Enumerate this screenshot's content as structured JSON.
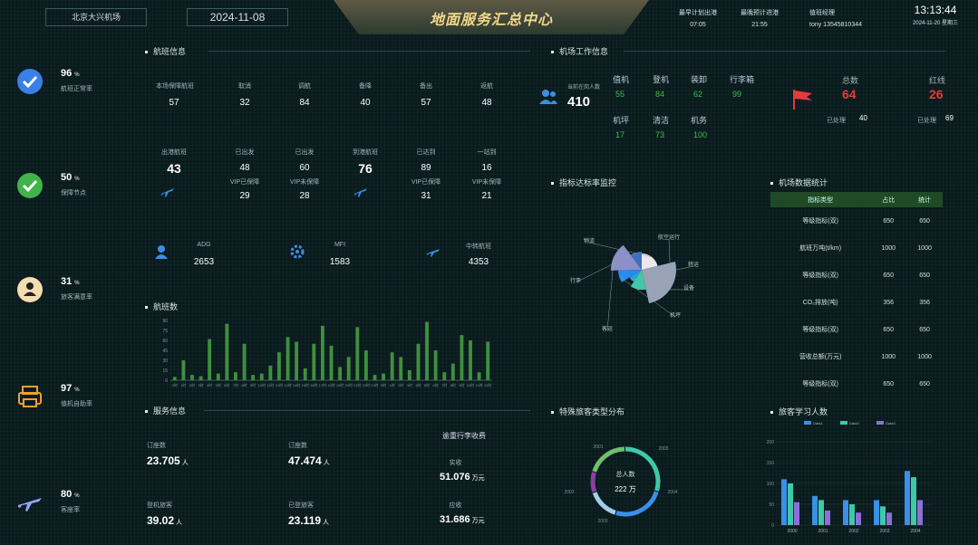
{
  "header": {
    "airport": "北京大兴机场",
    "date": "2024-11-08",
    "title": "地面服务汇总中心",
    "first_flight_label": "最早计划出港",
    "first_flight_time": "07:05",
    "last_flight_label": "最晚预计进港",
    "last_flight_time": "21:55",
    "duty_label": "值班经理",
    "duty_person": "tony 13545810344",
    "clock": "13:13:44",
    "clock_date": "2024-11-20 星期三"
  },
  "kpis": [
    {
      "value": "96",
      "unit": "%",
      "label": "航班正常率",
      "icon": "check-badge-icon"
    },
    {
      "value": "50",
      "unit": "%",
      "label": "保障节点",
      "icon": "check-circle-icon"
    },
    {
      "value": "31",
      "unit": "%",
      "label": "旅客满意率",
      "icon": "user-icon"
    },
    {
      "value": "97",
      "unit": "%",
      "label": "值机自助率",
      "icon": "printer-icon"
    },
    {
      "value": "80",
      "unit": "%",
      "label": "客座率",
      "icon": "plane-icon"
    }
  ],
  "flight_info": {
    "title": "航班信息",
    "row1": [
      {
        "label": "本场保障航班",
        "value": "57"
      },
      {
        "label": "取消",
        "value": "32"
      },
      {
        "label": "调航",
        "value": "84"
      },
      {
        "label": "备降",
        "value": "40"
      },
      {
        "label": "备出",
        "value": "57"
      },
      {
        "label": "返航",
        "value": "48"
      }
    ],
    "row2": [
      {
        "label": "出港航班",
        "value": "43",
        "big": true
      },
      {
        "label": "已出发",
        "value": "48"
      },
      {
        "label": "已出发",
        "value": "60"
      },
      {
        "label": "到港航班",
        "value": "76",
        "big": true
      },
      {
        "label": "已达到",
        "value": "89"
      },
      {
        "label": "一站到",
        "value": "16"
      }
    ],
    "row3": [
      {
        "label": "VIP已保障",
        "value": "29"
      },
      {
        "label": "VIP未保障",
        "value": "28"
      },
      {
        "label": "VIP已保障",
        "value": "31"
      },
      {
        "label": "VIP未保障",
        "value": "21"
      }
    ],
    "row4": [
      {
        "label": "ADG",
        "value": "2653",
        "icon": "user-icon"
      },
      {
        "label": "MFI",
        "value": "1583",
        "icon": "gear-icon"
      },
      {
        "label": "中转航班",
        "value": "4353",
        "icon": "plane-icon"
      }
    ]
  },
  "bar_chart": {
    "title": "航班数",
    "yticks": [
      "90",
      "75",
      "60",
      "45",
      "30",
      "15",
      "0"
    ]
  },
  "chart_data": [
    {
      "type": "bar",
      "title": "航班数",
      "categories": [
        "0时",
        "1时",
        "2时",
        "3时",
        "4时",
        "5时",
        "6时",
        "7时",
        "8时",
        "9时",
        "10时",
        "11时",
        "12时",
        "13时",
        "14时",
        "15时",
        "16时",
        "17时",
        "18时",
        "19时",
        "20时",
        "21时",
        "22时",
        "23时",
        "0时",
        "1时",
        "2时",
        "3时",
        "4时",
        "5时",
        "6时",
        "7时",
        "8时",
        "9时",
        "10时",
        "11时",
        "12时"
      ],
      "values": [
        5,
        30,
        8,
        6,
        62,
        10,
        85,
        12,
        55,
        8,
        10,
        22,
        42,
        65,
        58,
        18,
        55,
        82,
        52,
        20,
        35,
        80,
        45,
        8,
        10,
        42,
        35,
        15,
        55,
        88,
        45,
        12,
        25,
        68,
        60,
        12,
        58
      ],
      "ylim": [
        0,
        90
      ]
    },
    {
      "type": "pie",
      "title": "指标达标率监控",
      "categories": [
        "物流",
        "航空运行",
        "设备",
        "转运",
        "机坪",
        "客运",
        "行李"
      ],
      "values": [
        25,
        30,
        15,
        8,
        10,
        18,
        12
      ]
    },
    {
      "type": "pie",
      "title": "特殊旅客类型分布",
      "categories": [
        "2001",
        "2002",
        "2003",
        "2004",
        "2005"
      ],
      "values": [
        30,
        25,
        15,
        10,
        20
      ]
    },
    {
      "type": "bar",
      "title": "旅客学习人数",
      "categories": [
        "2000",
        "2001",
        "2002",
        "2003",
        "2004"
      ],
      "series": [
        {
          "name": "Data1",
          "values": [
            110,
            70,
            60,
            60,
            130
          ]
        },
        {
          "name": "Data2",
          "values": [
            100,
            60,
            50,
            45,
            115
          ]
        },
        {
          "name": "Data3",
          "values": [
            55,
            35,
            30,
            30,
            60
          ]
        }
      ],
      "ylim": [
        0,
        200
      ]
    }
  ],
  "service_info": {
    "title": "服务信息",
    "items": [
      {
        "label": "订座数",
        "value": "23.705",
        "unit": "人"
      },
      {
        "label": "订座数",
        "value": "47.474",
        "unit": "人"
      },
      {
        "label": "登机旅客",
        "value": "39.02",
        "unit": "人"
      },
      {
        "label": "已登旅客",
        "value": "23.119",
        "unit": "人"
      }
    ],
    "luggage_title": "逾重行李收费",
    "luggage": [
      {
        "label": "实收",
        "value": "51.076",
        "unit": "万元"
      },
      {
        "label": "应收",
        "value": "31.686",
        "unit": "万元"
      }
    ]
  },
  "work_info": {
    "title": "机场工作信息",
    "staff_label": "当前在岗人数",
    "staff_value": "410",
    "grid": [
      {
        "label": "值机",
        "value": "55"
      },
      {
        "label": "登机",
        "value": "84"
      },
      {
        "label": "装卸",
        "value": "62"
      },
      {
        "label": "行李箱",
        "value": "99"
      },
      {
        "label": "机坪",
        "value": "17"
      },
      {
        "label": "清洁",
        "value": "73"
      },
      {
        "label": "机务",
        "value": "100"
      }
    ],
    "total_label": "总数",
    "total_value": "64",
    "red_label": "红线",
    "red_value": "26",
    "done_label": "已处理",
    "done_value": "40",
    "pending_label": "已处理",
    "pending_value": "69"
  },
  "pie1": {
    "title": "指标达标率监控"
  },
  "pie2": {
    "title": "特殊旅客类型分布",
    "center_label": "总人数",
    "center_value": "222 万"
  },
  "stat_table": {
    "title": "机场数据统计",
    "headers": [
      "指标类型",
      "占比",
      "统计"
    ],
    "rows": [
      [
        "等级指标(双)",
        "650",
        "650"
      ],
      [
        "航班万吨(t/km)",
        "1000",
        "1000"
      ],
      [
        "等级指标(双)",
        "650",
        "650"
      ],
      [
        "CO₂排放(吨)",
        "356",
        "356"
      ],
      [
        "等级指标(双)",
        "650",
        "650"
      ],
      [
        "营收总额(万元)",
        "1000",
        "1000"
      ],
      [
        "等级指标(双)",
        "650",
        "650"
      ]
    ]
  },
  "grouped_bar": {
    "title": "旅客学习人数",
    "legend": [
      "Data1",
      "Data2",
      "Data3"
    ],
    "yticks": [
      "200",
      "150",
      "100",
      "50",
      "0"
    ]
  },
  "colors": {
    "accent_green": "#3bbf4b",
    "red": "#e33b3b",
    "blue": "#3a8fe6",
    "gold": "#f2d78a"
  }
}
